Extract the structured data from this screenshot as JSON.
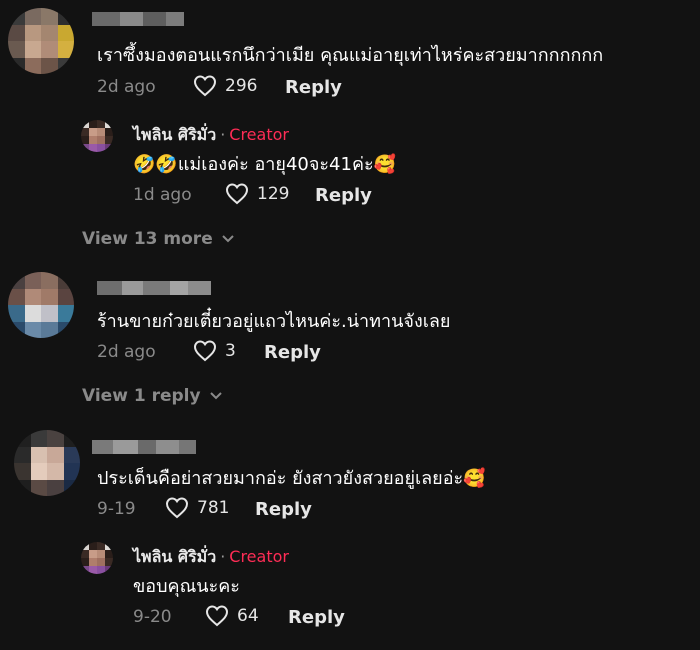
{
  "comments": [
    {
      "id": "c1",
      "text": "เราซึ้งมองตอนแรกนึกว่าเมีย คุณแม่อายุเท่าไหร่คะสวยมากกกกกก",
      "time": "2d ago",
      "likes": "296",
      "reply_label": "Reply",
      "replies": [
        {
          "author": "ไพลิน ศิริมั่ว",
          "separator": "·",
          "badge": "Creator",
          "text": "🤣🤣แม่เองค่ะ อายุ40จะ41ค่ะ🥰",
          "time": "1d ago",
          "likes": "129",
          "reply_label": "Reply"
        }
      ],
      "view_more": "View 13 more"
    },
    {
      "id": "c2",
      "text": "ร้านขายก๋วยเตี๋ยวอยู่แถวไหนค่ะ.น่าทานจังเลย",
      "time": "2d ago",
      "likes": "3",
      "reply_label": "Reply",
      "view_more": "View 1 reply"
    },
    {
      "id": "c3",
      "text": "ประเด็นคือย่าสวยมากอ่ะ ยังสาวยังสวยอยู่เลยอ่ะ🥰",
      "time": "9-19",
      "likes": "781",
      "reply_label": "Reply",
      "replies": [
        {
          "author": "ไพลิน ศิริมั่ว",
          "separator": "·",
          "badge": "Creator",
          "text": "ขอบคุณนะคะ",
          "time": "9-20",
          "likes": "64",
          "reply_label": "Reply"
        }
      ]
    }
  ],
  "colors": {
    "background": "#121212",
    "creator_badge": "#fe2c55",
    "secondary_text": "#8a8a8a"
  }
}
